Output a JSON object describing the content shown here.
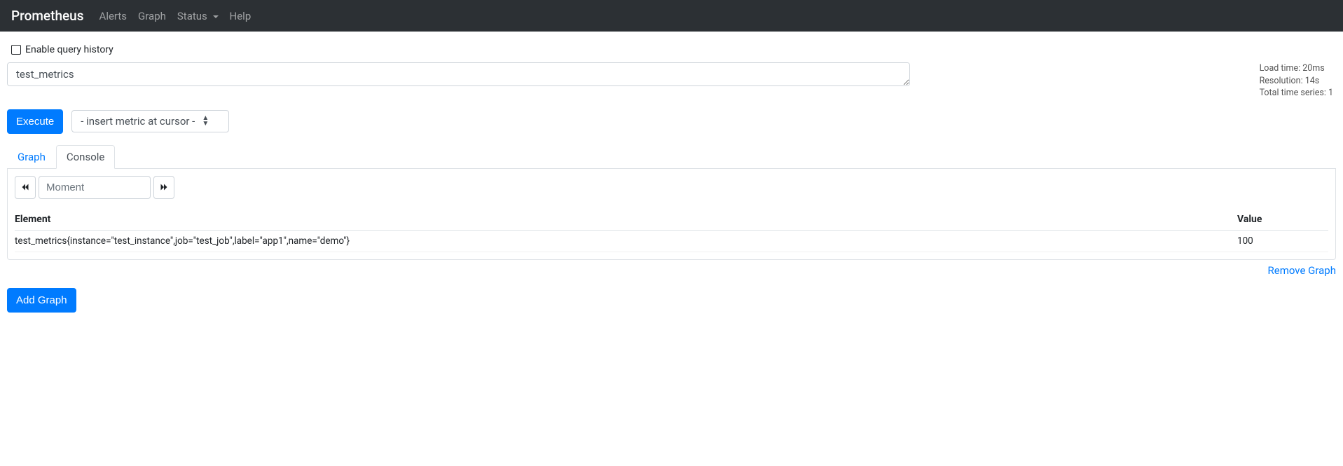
{
  "brand": "Prometheus",
  "nav": {
    "alerts": "Alerts",
    "graph": "Graph",
    "status": "Status",
    "help": "Help"
  },
  "history": {
    "label": "Enable query history",
    "checked": false
  },
  "query": {
    "expression": "test_metrics",
    "stats": {
      "load_time": "Load time: 20ms",
      "resolution": "Resolution: 14s",
      "series": "Total time series: 1"
    }
  },
  "controls": {
    "execute": "Execute",
    "metric_placeholder": "- insert metric at cursor -"
  },
  "tabs": {
    "graph": "Graph",
    "console": "Console"
  },
  "moment": {
    "placeholder": "Moment",
    "value": ""
  },
  "table": {
    "headers": {
      "element": "Element",
      "value": "Value"
    },
    "rows": [
      {
        "element": "test_metrics{instance=\"test_instance\",job=\"test_job\",label=\"app1\",name=\"demo\"}",
        "value": "100"
      }
    ]
  },
  "links": {
    "remove": "Remove Graph",
    "add": "Add Graph"
  }
}
